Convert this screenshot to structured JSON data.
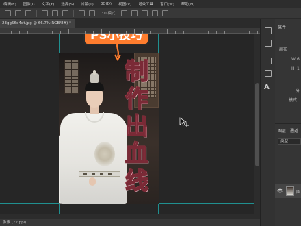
{
  "menu": {
    "items": [
      "编辑(E)",
      "图像(I)",
      "文字(Y)",
      "选择(S)",
      "滤镜(T)",
      "3D(D)",
      "视图(V)",
      "增效工具",
      "窗口(W)",
      "帮助(H)"
    ]
  },
  "options_bar": {
    "icons": [
      "align-left-icon",
      "align-center-icon",
      "align-right-icon",
      "align-top-icon",
      "align-middle-icon",
      "align-bottom-icon",
      "distribute-icon",
      "more-icon"
    ],
    "mode_label": "3D 模式：",
    "mode_icons": [
      "orbit-icon",
      "roll-icon",
      "pan-icon",
      "slide-icon",
      "scale-icon"
    ]
  },
  "document": {
    "tab_title": "23gg56o4qt.jpg @ 66.7%(RGB/8#) *"
  },
  "canvas": {
    "image_pill_text": "PS小技巧",
    "image_big_text": [
      "制",
      "作",
      "出",
      "血",
      "线"
    ]
  },
  "status": {
    "text": "像素 (72 ppi)"
  },
  "right_panel": {
    "props_tab": "属性",
    "section_label": "画布",
    "w_label": "W",
    "w_value": "6",
    "h_label": "H",
    "h_value": "1",
    "split_label": "分",
    "mode_label": "模式",
    "layers_tab": "图层",
    "channels_tab": "通道",
    "filter_label": "类型",
    "layer_name": "图"
  },
  "colors": {
    "pill_bg": "#ff7d2e",
    "big_text": "#e87e90",
    "guide": "#1fb4b4"
  }
}
